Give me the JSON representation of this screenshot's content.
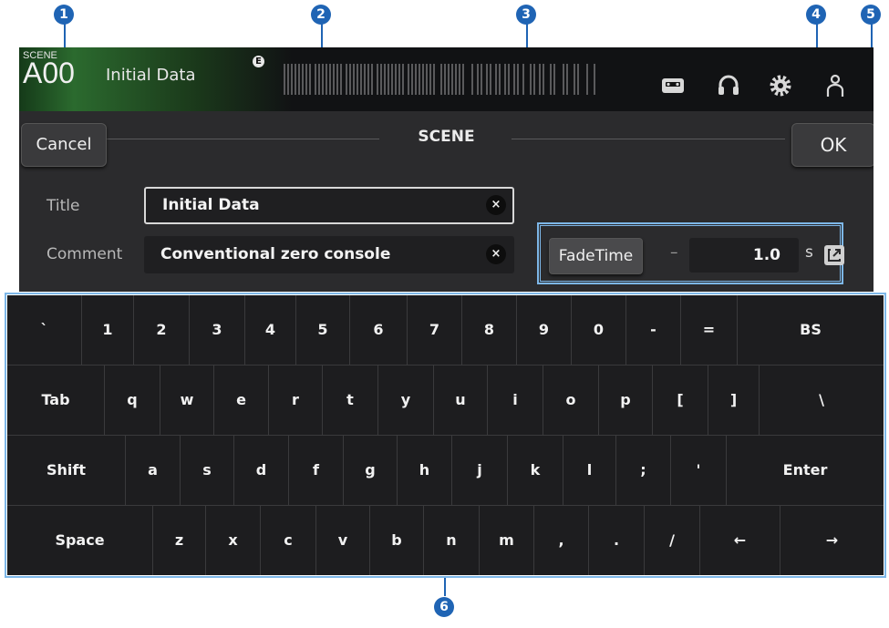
{
  "callouts": [
    "1",
    "2",
    "3",
    "4",
    "5",
    "6"
  ],
  "topbar": {
    "scene_label": "SCENE",
    "scene_number": "A00",
    "scene_name": "Initial Data",
    "edited_badge": "E"
  },
  "dialog": {
    "title": "SCENE",
    "cancel_label": "Cancel",
    "ok_label": "OK"
  },
  "form": {
    "title_label": "Title",
    "title_value": "Initial Data",
    "comment_label": "Comment",
    "comment_value": "Conventional zero console",
    "clear_symbol": "×",
    "fade_label": "FadeTime",
    "fade_dash": "–",
    "fade_value": "1.0",
    "fade_unit": "s"
  },
  "keyboard": {
    "rows": [
      [
        "`",
        "1",
        "2",
        "3",
        "4",
        "5",
        "6",
        "7",
        "8",
        "9",
        "0",
        "-",
        "=",
        "BS"
      ],
      [
        "Tab",
        "q",
        "w",
        "e",
        "r",
        "t",
        "y",
        "u",
        "i",
        "o",
        "p",
        "[",
        "]",
        "\\"
      ],
      [
        "Shift",
        "a",
        "s",
        "d",
        "f",
        "g",
        "h",
        "j",
        "k",
        "l",
        ";",
        "'",
        "Enter"
      ],
      [
        "Space",
        "z",
        "x",
        "c",
        "v",
        "b",
        "n",
        "m",
        ",",
        ".",
        "/",
        "←",
        "→"
      ]
    ]
  },
  "colors": {
    "callout": "#1f64b4",
    "highlight": "#7db7e8"
  }
}
